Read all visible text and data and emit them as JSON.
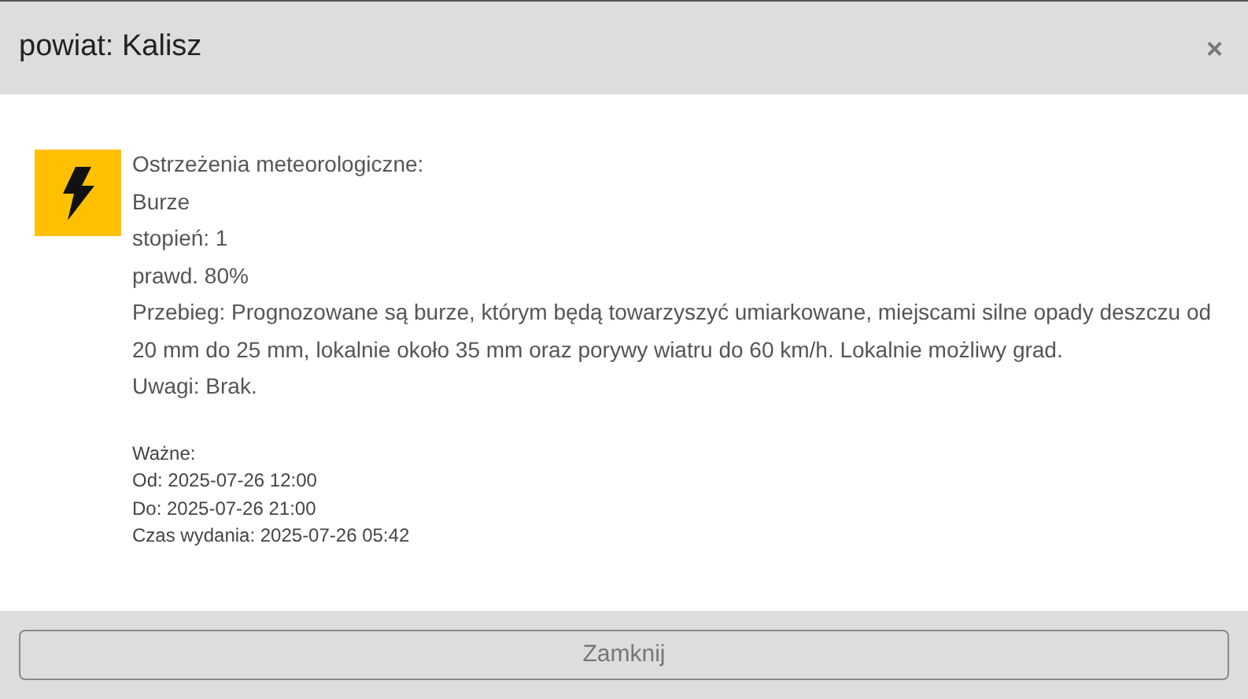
{
  "dialog": {
    "title": "powiat: Kalisz",
    "close": "×"
  },
  "warning": {
    "heading": "Ostrzeżenia meteorologiczne:",
    "type": "Burze",
    "degree": "stopień: 1",
    "probability": "prawd. 80%",
    "course": "Przebieg: Prognozowane są burze, którym będą towarzyszyć umiarkowane, miejscami silne opady deszczu od 20 mm do 25 mm, lokalnie około 35 mm oraz porywy wiatru do 60 km/h. Lokalnie możliwy grad.",
    "remarks": "Uwagi: Brak."
  },
  "validity": [
    "Ważne:",
    "Od: 2025-07-26 12:00",
    "Do: 2025-07-26 21:00",
    "Czas wydania: 2025-07-26 05:42"
  ],
  "buttons": [
    "Zamknij"
  ]
}
